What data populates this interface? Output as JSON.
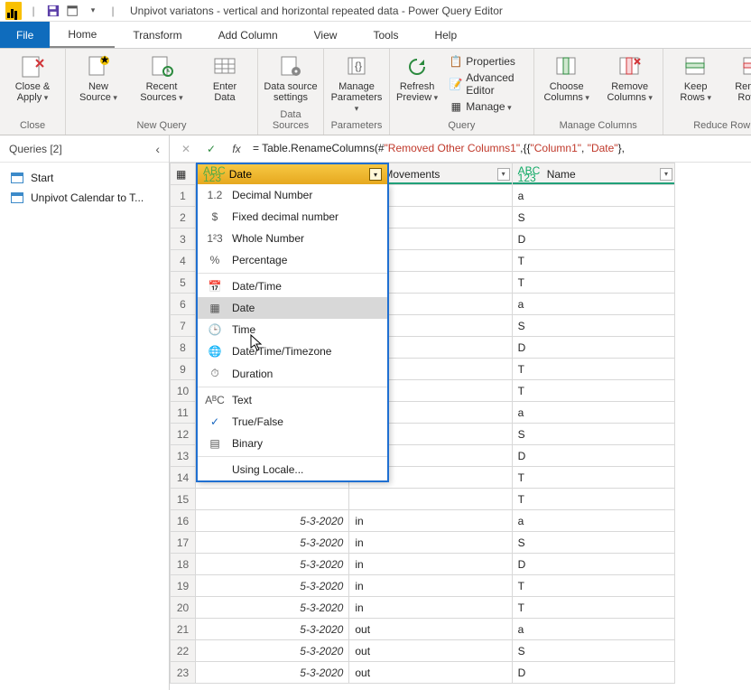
{
  "title": "Unpivot variatons  - vertical and horizontal repeated data - Power Query Editor",
  "menu": {
    "file": "File",
    "home": "Home",
    "transform": "Transform",
    "addcolumn": "Add Column",
    "view": "View",
    "tools": "Tools",
    "help": "Help"
  },
  "ribbon": {
    "close_apply": "Close &\nApply",
    "close_group": "Close",
    "new_source": "New\nSource",
    "recent_sources": "Recent\nSources",
    "enter_data": "Enter\nData",
    "new_query_group": "New Query",
    "data_source_settings": "Data source\nsettings",
    "data_sources_group": "Data Sources",
    "manage_params": "Manage\nParameters",
    "parameters_group": "Parameters",
    "refresh_preview": "Refresh\nPreview",
    "properties": "Properties",
    "advanced_editor": "Advanced Editor",
    "manage": "Manage",
    "query_group": "Query",
    "choose_columns": "Choose\nColumns",
    "remove_columns": "Remove\nColumns",
    "manage_columns_group": "Manage Columns",
    "keep_rows": "Keep\nRows",
    "remove_rows": "Remove\nRows",
    "reduce_rows_group": "Reduce Row"
  },
  "sidebar": {
    "header": "Queries [2]",
    "items": [
      "Start",
      "Unpivot Calendar to T..."
    ]
  },
  "formula": {
    "pre": "= Table.RenameColumns(#",
    "mid": "\"Removed Other Columns1\"",
    ",": " ,{{",
    "s1": "\"Column1\"",
    "s2": "\"Date\"",
    "tail": "},"
  },
  "columns": {
    "date": "Date",
    "movements": "Movements",
    "name": "Name"
  },
  "rows": [
    {
      "n": 1,
      "name": "a"
    },
    {
      "n": 2,
      "name": "S"
    },
    {
      "n": 3,
      "name": "D"
    },
    {
      "n": 4,
      "name": "T"
    },
    {
      "n": 5,
      "name": "T"
    },
    {
      "n": 6,
      "name": "a"
    },
    {
      "n": 7,
      "name": "S"
    },
    {
      "n": 8,
      "name": "D"
    },
    {
      "n": 9,
      "name": "T"
    },
    {
      "n": 10,
      "name": "T"
    },
    {
      "n": 11,
      "name": "a"
    },
    {
      "n": 12,
      "name": "S"
    },
    {
      "n": 13,
      "name": "D"
    },
    {
      "n": 14,
      "name": "T"
    },
    {
      "n": 15,
      "name": "T"
    },
    {
      "n": 16,
      "date": "5-3-2020",
      "mov": "in",
      "name": "a"
    },
    {
      "n": 17,
      "date": "5-3-2020",
      "mov": "in",
      "name": "S"
    },
    {
      "n": 18,
      "date": "5-3-2020",
      "mov": "in",
      "name": "D"
    },
    {
      "n": 19,
      "date": "5-3-2020",
      "mov": "in",
      "name": "T"
    },
    {
      "n": 20,
      "date": "5-3-2020",
      "mov": "in",
      "name": "T"
    },
    {
      "n": 21,
      "date": "5-3-2020",
      "mov": "out",
      "name": "a"
    },
    {
      "n": 22,
      "date": "5-3-2020",
      "mov": "out",
      "name": "S"
    },
    {
      "n": 23,
      "date": "5-3-2020",
      "mov": "out",
      "name": "D"
    }
  ],
  "type_menu": {
    "decimal": "Decimal Number",
    "fixed": "Fixed decimal number",
    "whole": "Whole Number",
    "percent": "Percentage",
    "datetime": "Date/Time",
    "date": "Date",
    "time": "Time",
    "dtz": "Date/Time/Timezone",
    "duration": "Duration",
    "text": "Text",
    "bool": "True/False",
    "binary": "Binary",
    "locale": "Using Locale..."
  },
  "type_icons": {
    "decimal": "1.2",
    "fixed": "$",
    "whole": "1²3",
    "percent": "%",
    "datetime": "📅",
    "date": "▦",
    "time": "🕒",
    "dtz": "🌐",
    "duration": "⏱",
    "text": "AᴮC",
    "bool": "✓",
    "binary": "▤",
    "locale": ""
  }
}
